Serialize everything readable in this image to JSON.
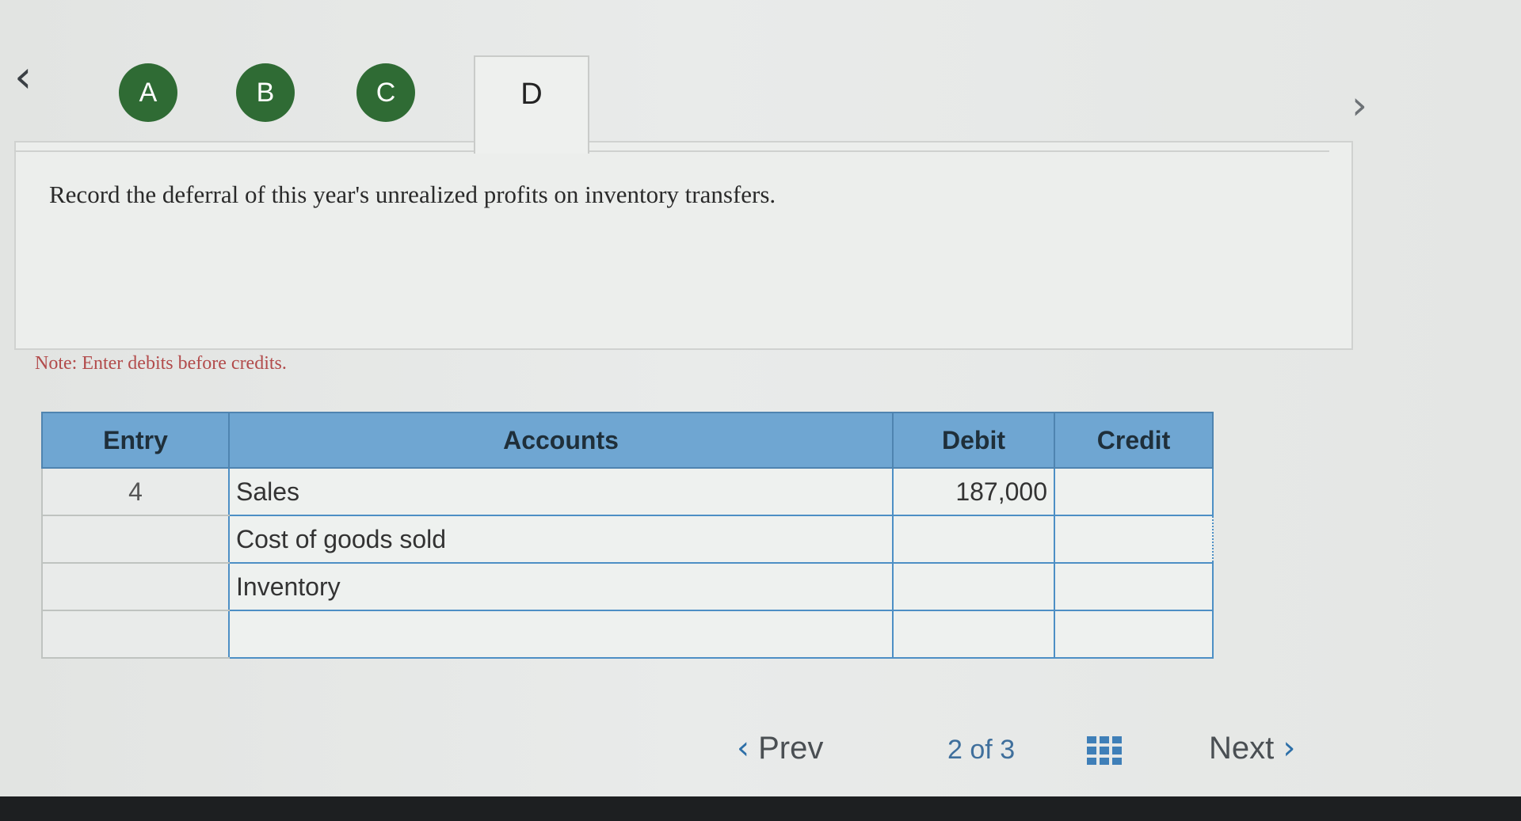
{
  "steps": [
    "A",
    "B",
    "C",
    "D"
  ],
  "active_step": "D",
  "question": "Record the deferral of this year's unrealized profits on inventory transfers.",
  "note": "Note: Enter debits before credits.",
  "table": {
    "headers": {
      "entry": "Entry",
      "accounts": "Accounts",
      "debit": "Debit",
      "credit": "Credit"
    },
    "rows": [
      {
        "entry": "4",
        "account": "Sales",
        "debit": "187,000",
        "credit": ""
      },
      {
        "entry": "",
        "account": "Cost of goods sold",
        "debit": "",
        "credit": ""
      },
      {
        "entry": "",
        "account": "Inventory",
        "debit": "",
        "credit": ""
      },
      {
        "entry": "",
        "account": "",
        "debit": "",
        "credit": ""
      }
    ]
  },
  "pagination": {
    "prev_label": "Prev",
    "current": "2",
    "of_label": "of",
    "total": "3",
    "next_label": "Next"
  },
  "colors": {
    "step_circle": "#2f6b34",
    "table_header": "#6fa6d2",
    "note_text": "#b24b4b",
    "pager_accent": "#2d6fa8"
  },
  "icons": {
    "nav_prev": "chevron-left-icon",
    "nav_next": "chevron-right-icon",
    "grid": "grid-icon"
  }
}
